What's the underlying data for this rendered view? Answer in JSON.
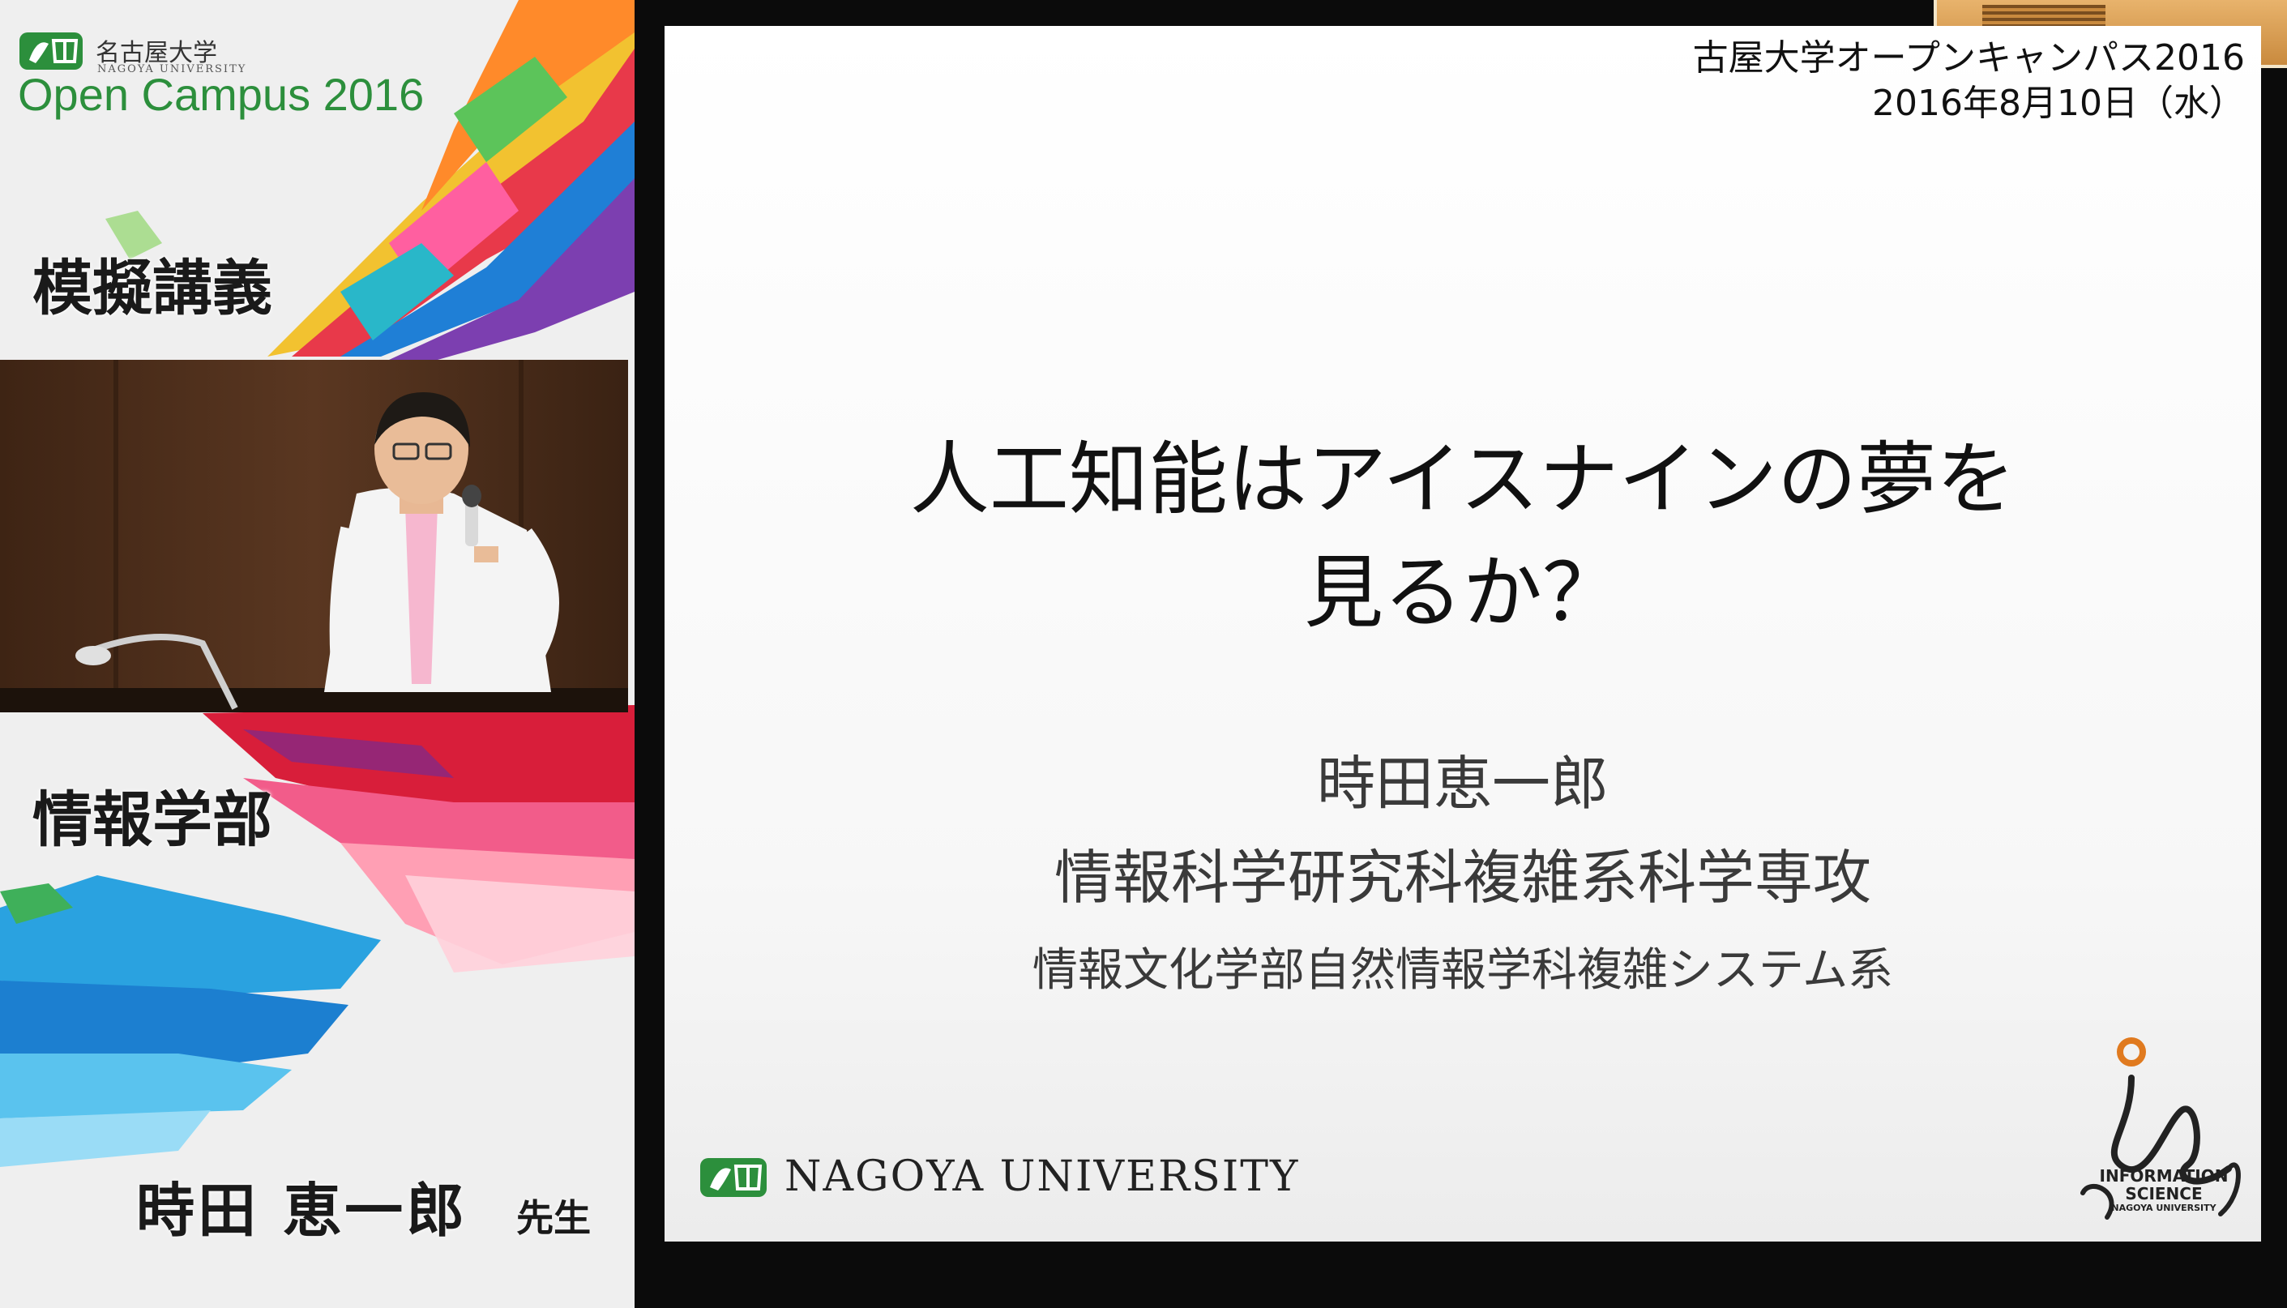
{
  "sidebar": {
    "brand_jp": "名古屋大学",
    "brand_en": "NAGOYA UNIVERSITY",
    "event_title": "Open Campus 2016",
    "session_label": "模擬講義",
    "faculty_label": "情報学部",
    "lecturer_name": "時田 恵一郎",
    "lecturer_title": "先生"
  },
  "slide": {
    "header_event": "古屋大学オープンキャンパス2016",
    "header_date": "2016年8月10日（水）",
    "title_line1": "人工知能はアイスナインの夢を",
    "title_line2": "見るか？",
    "author": "時田恵一郎",
    "department1": "情報科学研究科複雑系科学専攻",
    "department2": "情報文化学部自然情報学科複雑システム系",
    "logo_text": "NAGOYA UNIVERSITY",
    "info_logo_line1": "INFORMATION",
    "info_logo_line2": "SCIENCE",
    "info_logo_line3": "NAGOYA UNIVERSITY"
  },
  "colors": {
    "brand_green": "#2c8f3c",
    "slide_background": "#ffffff",
    "left_panel_background": "#efefef"
  }
}
